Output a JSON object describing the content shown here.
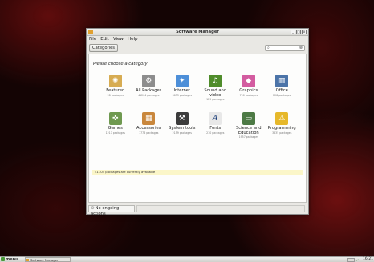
{
  "window": {
    "title": "Software Manager",
    "controls": [
      "_",
      "□",
      "x"
    ]
  },
  "menubar": [
    "File",
    "Edit",
    "View",
    "Help"
  ],
  "toolbar": {
    "categories_label": "Categories",
    "search_placeholder": ""
  },
  "main": {
    "heading": "Please choose a category",
    "categories": [
      {
        "label": "Featured",
        "count": "28 packages",
        "icon": "star-icon",
        "color": "#d7ac52",
        "glyph": "✺"
      },
      {
        "label": "All Packages",
        "count": "41204 packages",
        "icon": "gear-icon",
        "color": "#8d8d8d",
        "glyph": "⚙"
      },
      {
        "label": "Internet",
        "count": "3633 packages",
        "icon": "globe-icon",
        "color": "#4d8fd8",
        "glyph": "✦"
      },
      {
        "label": "Sound and video",
        "count": "129 packages",
        "icon": "music-icon",
        "color": "#4f8c2a",
        "glyph": "♫"
      },
      {
        "label": "Graphics",
        "count": "790 packages",
        "icon": "palette-icon",
        "color": "#d35ca0",
        "glyph": "◆"
      },
      {
        "label": "Office",
        "count": "228 packages",
        "icon": "chart-icon",
        "color": "#4c74a8",
        "glyph": "▥"
      },
      {
        "label": "Games",
        "count": "1217 packages",
        "icon": "gamepad-icon",
        "color": "#6f9950",
        "glyph": "✜"
      },
      {
        "label": "Accessories",
        "count": "1776 packages",
        "icon": "calculator-icon",
        "color": "#c9873c",
        "glyph": "▦"
      },
      {
        "label": "System tools",
        "count": "2159 packages",
        "icon": "terminal-icon",
        "color": "#3c3c3c",
        "glyph": "⚒"
      },
      {
        "label": "Fonts",
        "count": "210 packages",
        "icon": "font-icon",
        "color": "#e8e8e8",
        "glyph": "A"
      },
      {
        "label": "Science and Education",
        "count": "1957 packages",
        "icon": "chalkboard-icon",
        "color": "#4d7a45",
        "glyph": "▭"
      },
      {
        "label": "Programming",
        "count": "3635 packages",
        "icon": "construction-icon",
        "color": "#e6b82a",
        "glyph": "⚠"
      }
    ],
    "info_bar": "41104 packages are currently available"
  },
  "statusbar": {
    "actions": "No ongoing actions"
  },
  "taskbar": {
    "menu_label": "menu",
    "task_label": "Software Manager",
    "clock": "16:21"
  }
}
